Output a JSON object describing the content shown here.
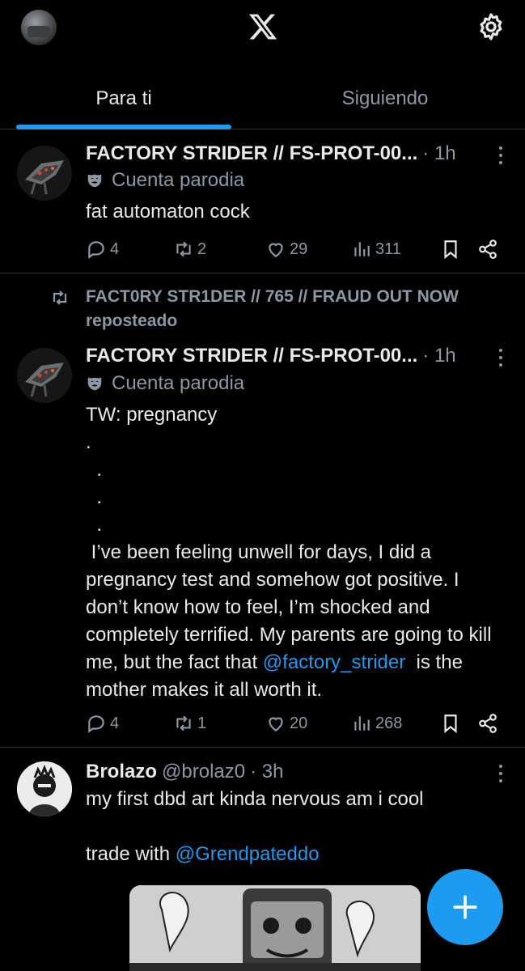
{
  "tabs": [
    {
      "label": "Para ti",
      "active": true
    },
    {
      "label": "Siguiendo",
      "active": false
    }
  ],
  "posts": [
    {
      "name": "FACTORY STRIDER // FS-PROT-00...",
      "time": "· 1h",
      "badge": "Cuenta parodia",
      "text": "fat automaton cock",
      "replies": "4",
      "reposts": "2",
      "likes": "29",
      "views": "311"
    },
    {
      "reposted_by": "FACT0RY STR1DER // 765 // FRAUD OUT NOW",
      "reposted_label": "reposteado",
      "name": "FACTORY STRIDER // FS-PROT-00...",
      "time": "· 1h",
      "badge": "Cuenta parodia",
      "text_before": "TW: pregnancy\n.\n  .\n  .\n  .\n I’ve been feeling unwell for days, I did a pregnancy test and somehow got positive. I don’t know how to feel, I’m shocked and completely terrified. My parents are going to kill me, but the fact that ",
      "mention": "@factory_strider",
      "text_after": "  is the mother makes it all worth it.",
      "replies": "4",
      "reposts": "1",
      "likes": "20",
      "views": "268"
    },
    {
      "name": "Brolazo",
      "handle": "@brolaz0",
      "time": "· 3h",
      "text": "my first dbd art kinda nervous am i cool\n\ntrade with ",
      "mention": "@Grendpateddo"
    }
  ],
  "colors": {
    "accent": "#1d9bf0",
    "muted": "#8b98a5",
    "text": "#e7e9ea",
    "divider": "#2f3336"
  },
  "icons": [
    "x-logo-icon",
    "gear-icon",
    "more-icon",
    "parody-mask-icon",
    "reply-icon",
    "repost-icon",
    "like-icon",
    "views-icon",
    "bookmark-icon",
    "share-icon",
    "compose-plus-icon"
  ]
}
